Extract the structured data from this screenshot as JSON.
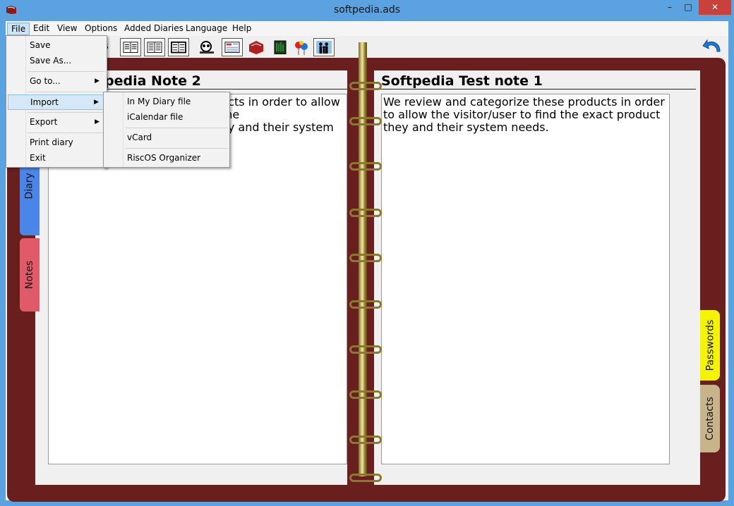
{
  "window": {
    "title": "softpedia.ads",
    "minimize": "–",
    "maximize": "□",
    "close": "✕"
  },
  "menubar": [
    "File",
    "Edit",
    "View",
    "Options",
    "Added Diaries",
    "Language",
    "Help"
  ],
  "file_menu": [
    "Save",
    "Save As...",
    "Go to...",
    "Import",
    "Export",
    "Print diary",
    "Exit"
  ],
  "import_submenu": [
    "In My Diary file",
    "iCalendar file",
    "vCard",
    "RiscOS Organizer"
  ],
  "toolbar": {
    "icons": [
      "year-view-icon",
      "month-view-icon",
      "week-view-icon",
      "search-icon",
      "notes-list-icon",
      "address-book-icon",
      "password-icon",
      "birthdays-icon",
      "family-icon"
    ],
    "partial_digit": "6",
    "undo_icon": "undo-arrow-icon"
  },
  "left_page": {
    "title": "pedia Note 2",
    "body": "ucts in order to allow the\ney and their system"
  },
  "right_page": {
    "title": "Softpedia Test note 1",
    "body": "We review and categorize these products in order to allow the visitor/user to find the exact product they and their system needs."
  },
  "tabs": {
    "diary": "Diary",
    "notes": "Notes",
    "passwords": "Passwords",
    "contacts": "Contacts"
  },
  "colors": {
    "binder": "#6a1f1f",
    "tab_diary": "#4a86e8",
    "tab_notes": "#e05a6a",
    "tab_passwords": "#f4f400",
    "tab_contacts": "#c8b48a"
  }
}
